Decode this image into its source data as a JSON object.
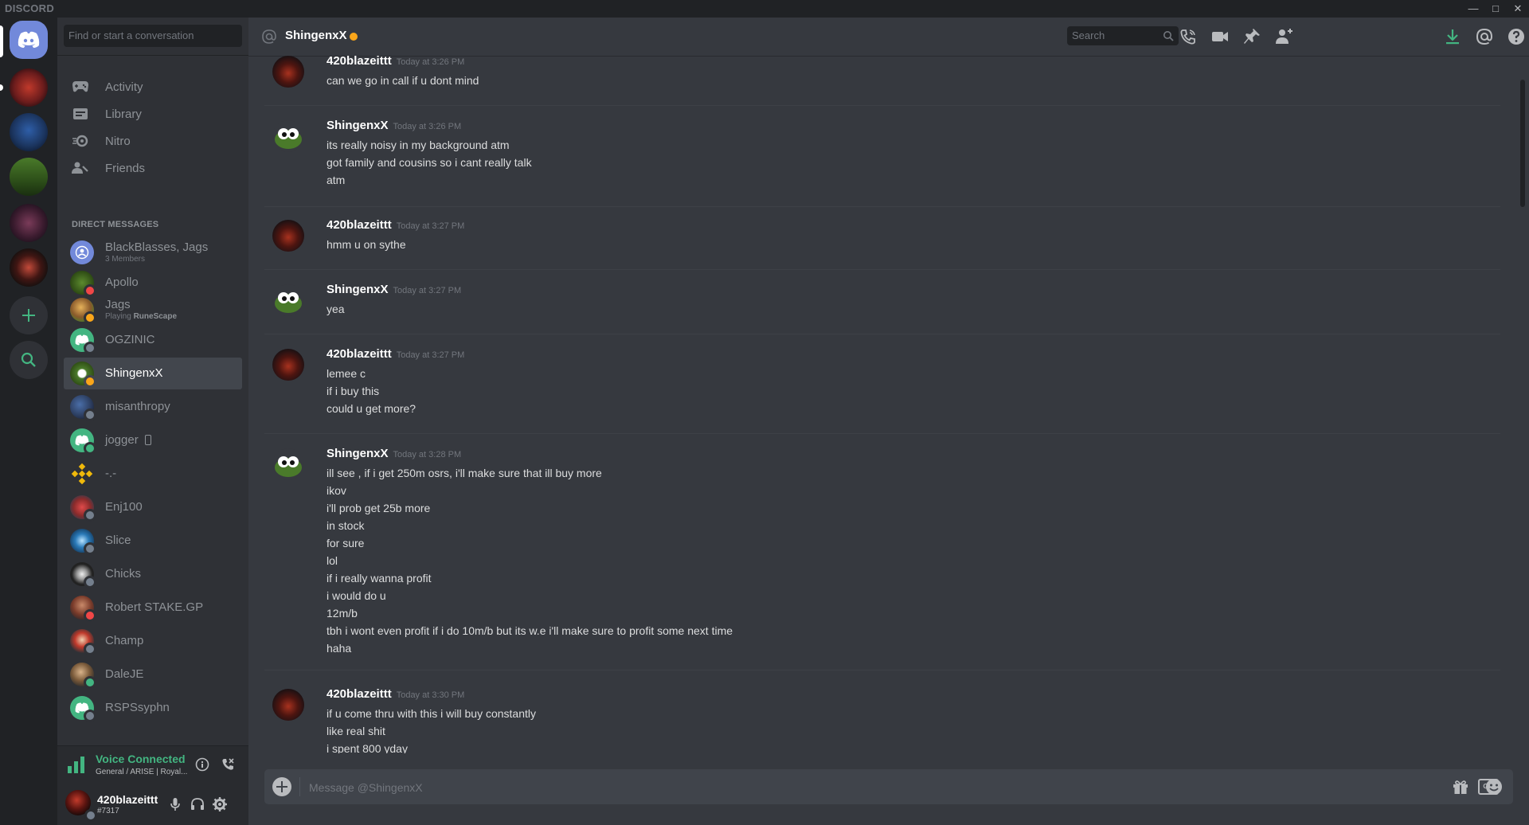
{
  "window": {
    "app_name": "DISCORD"
  },
  "sidebar": {
    "search_placeholder": "Find or start a conversation",
    "nav": [
      {
        "label": "Activity",
        "icon": "gamepad-icon"
      },
      {
        "label": "Library",
        "icon": "library-icon"
      },
      {
        "label": "Nitro",
        "icon": "nitro-icon"
      },
      {
        "label": "Friends",
        "icon": "friends-icon"
      }
    ],
    "dm_header": "DIRECT MESSAGES",
    "dms": [
      {
        "name": "BlackBlasses, Jags",
        "sub": "3 Members",
        "status": "none"
      },
      {
        "name": "Apollo",
        "sub": "",
        "status": "dnd"
      },
      {
        "name": "Jags",
        "sub_prefix": "Playing ",
        "sub_game": "RuneScape",
        "status": "idle"
      },
      {
        "name": "OGZINIC",
        "sub": "",
        "status": "offline"
      },
      {
        "name": "ShingenxX",
        "sub": "",
        "status": "idle",
        "active": true
      },
      {
        "name": "misanthropy",
        "sub": "",
        "status": "offline"
      },
      {
        "name": "jogger",
        "sub": "",
        "status": "online",
        "mobile": true
      },
      {
        "name": "-.-",
        "sub": "",
        "status": "none"
      },
      {
        "name": "Enj100",
        "sub": "",
        "status": "offline"
      },
      {
        "name": "Slice",
        "sub": "",
        "status": "offline"
      },
      {
        "name": "Chicks",
        "sub": "",
        "status": "offline"
      },
      {
        "name": "Robert STAKE.GP",
        "sub": "",
        "status": "dnd"
      },
      {
        "name": "Champ",
        "sub": "",
        "status": "offline"
      },
      {
        "name": "DaleJE",
        "sub": "",
        "status": "online"
      },
      {
        "name": "RSPSsyphn",
        "sub": "",
        "status": "offline"
      }
    ]
  },
  "voice": {
    "title": "Voice Connected",
    "subtitle": "General / ARISE | Royal..."
  },
  "user": {
    "name": "420blazeittt",
    "discriminator": "#7317"
  },
  "header": {
    "channel": "ShingenxX",
    "search_placeholder": "Search"
  },
  "messages": [
    {
      "author": "420blazeittt",
      "time": "Today at 3:26 PM",
      "lines": [
        "can we go in call if u dont mind"
      ]
    },
    {
      "author": "ShingenxX",
      "time": "Today at 3:26 PM",
      "lines": [
        "its really noisy in my background atm",
        "got family and cousins so i cant really talk",
        "atm"
      ]
    },
    {
      "author": "420blazeittt",
      "time": "Today at 3:27 PM",
      "lines": [
        "hmm u on sythe"
      ]
    },
    {
      "author": "ShingenxX",
      "time": "Today at 3:27 PM",
      "lines": [
        "yea"
      ]
    },
    {
      "author": "420blazeittt",
      "time": "Today at 3:27 PM",
      "lines": [
        "lemee c",
        "if i buy this",
        "could u get more?"
      ]
    },
    {
      "author": "ShingenxX",
      "time": "Today at 3:28 PM",
      "lines": [
        "ill see , if i get 250m osrs, i'll make sure that ill buy more",
        "ikov",
        "i'll prob get 25b more",
        "in stock",
        "for sure",
        "lol",
        "if i really wanna profit",
        "i would do u",
        "12m/b",
        "tbh i wont even profit if i do 10m/b but its w.e i'll make sure to profit some next time",
        "haha"
      ]
    },
    {
      "author": "420blazeittt",
      "time": "Today at 3:30 PM",
      "lines": [
        "if u come thru with this i will buy constantly",
        "like real shit",
        "i spent 800 yday"
      ]
    }
  ],
  "composer": {
    "placeholder": "Message @ShingenxX",
    "gif_label": "GIF"
  },
  "colors": {
    "accent": "#7289da",
    "online": "#43b581",
    "idle": "#faa61a",
    "dnd": "#f04747",
    "offline": "#747f8d"
  }
}
